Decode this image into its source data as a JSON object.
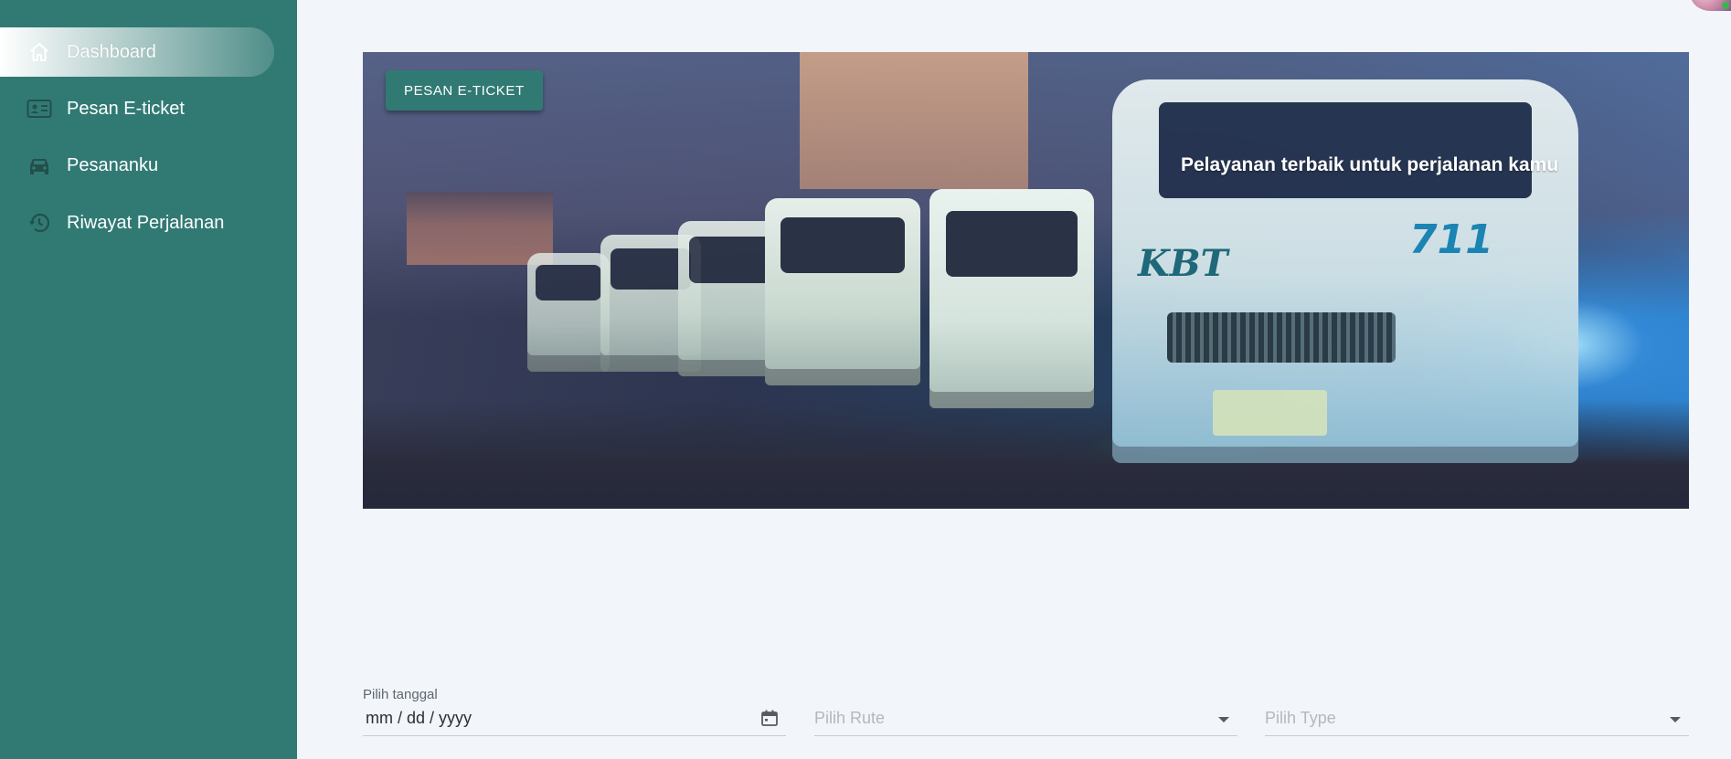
{
  "sidebar": {
    "items": [
      {
        "label": "Dashboard",
        "icon": "home-icon",
        "active": true
      },
      {
        "label": "Pesan E-ticket",
        "icon": "id-card-icon",
        "active": false
      },
      {
        "label": "Pesananku",
        "icon": "car-icon",
        "active": false
      },
      {
        "label": "Riwayat Perjalanan",
        "icon": "history-icon",
        "active": false
      }
    ]
  },
  "hero": {
    "button_label": "PESAN E-TICKET",
    "tagline": "Pelayanan terbaik untuk perjalanan kamu",
    "van_text": {
      "brand": "KBT",
      "number": "711"
    }
  },
  "form": {
    "date": {
      "label": "Pilih tanggal",
      "value": "mm / dd / yyyy",
      "icon": "calendar-icon"
    },
    "route": {
      "placeholder": "Pilih Rute",
      "icon": "chevron-down-icon"
    },
    "type": {
      "placeholder": "Pilih Type",
      "icon": "chevron-down-icon"
    }
  },
  "colors": {
    "primary": "#317a74",
    "background": "#f2f5fa",
    "sidebar_text": "#ffffff"
  }
}
